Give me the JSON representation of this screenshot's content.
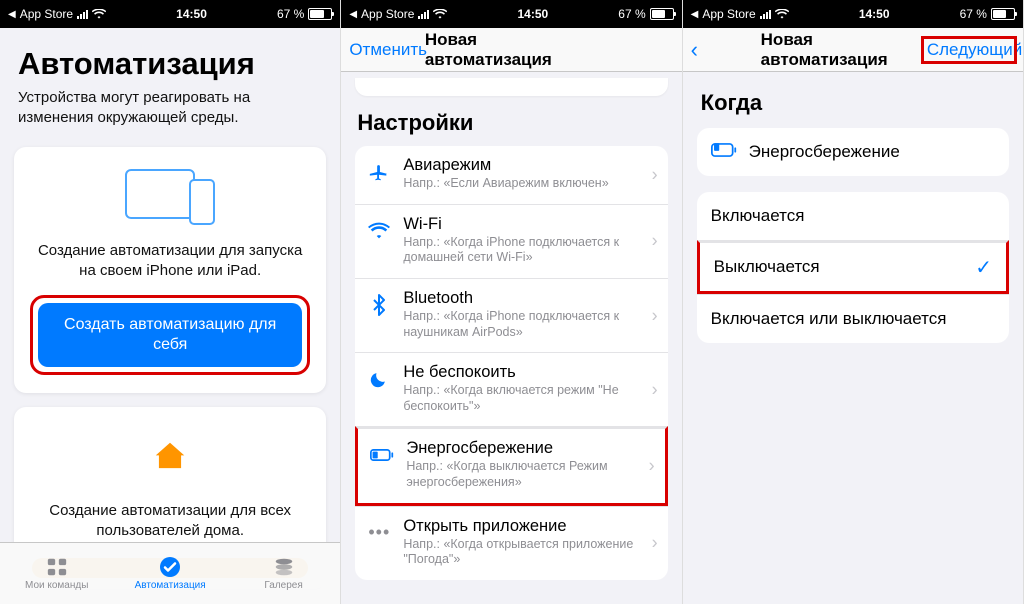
{
  "status": {
    "back_app": "App Store",
    "time": "14:50",
    "battery_pct": "67 %"
  },
  "screen1": {
    "title": "Автоматизация",
    "subtitle": "Устройства могут реагировать на изменения окружающей среды.",
    "card1_text": "Создание автоматизации для запуска на своем iPhone или iPad.",
    "card1_button": "Создать автоматизацию для себя",
    "card2_text": "Создание автоматизации для всех пользователей дома.",
    "tabs": {
      "shortcuts": "Мои команды",
      "automation": "Автоматизация",
      "gallery": "Галерея"
    }
  },
  "screen2": {
    "nav_cancel": "Отменить",
    "nav_title": "Новая автоматизация",
    "section": "Настройки",
    "rows": [
      {
        "title": "Авиарежим",
        "sub": "Напр.: «Если Авиарежим включен»"
      },
      {
        "title": "Wi-Fi",
        "sub": "Напр.: «Когда iPhone подключается к домашней сети Wi-Fi»"
      },
      {
        "title": "Bluetooth",
        "sub": "Напр.: «Когда iPhone подключается к наушникам AirPods»"
      },
      {
        "title": "Не беспокоить",
        "sub": "Напр.: «Когда включается режим \"Не беспокоить\"»"
      },
      {
        "title": "Энергосбережение",
        "sub": "Напр.: «Когда выключается Режим энергосбережения»"
      },
      {
        "title": "Открыть приложение",
        "sub": "Напр.: «Когда открывается приложение \"Погода\"»"
      }
    ]
  },
  "screen3": {
    "nav_title": "Новая автоматизация",
    "nav_next": "Следующий",
    "section": "Когда",
    "trigger": "Энергосбережение",
    "options": [
      "Включается",
      "Выключается",
      "Включается или выключается"
    ],
    "selected_index": 1
  }
}
